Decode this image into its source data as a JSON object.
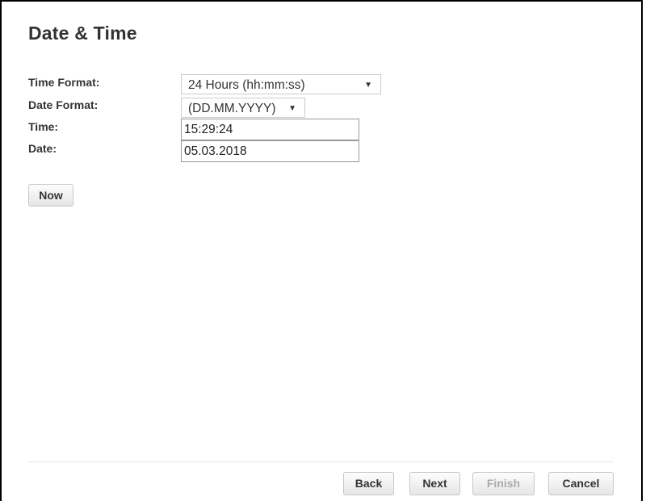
{
  "page": {
    "title": "Date & Time"
  },
  "form": {
    "time_format": {
      "label": "Time Format:",
      "value": "24 Hours (hh:mm:ss)"
    },
    "date_format": {
      "label": "Date Format:",
      "value": "(DD.MM.YYYY)"
    },
    "time": {
      "label": "Time:",
      "value": "15:29:24"
    },
    "date": {
      "label": "Date:",
      "value": "05.03.2018"
    }
  },
  "now_button": {
    "label": "Now"
  },
  "footer": {
    "back_label": "Back",
    "next_label": "Next",
    "finish_label": "Finish",
    "finish_enabled": false,
    "cancel_label": "Cancel"
  },
  "icons": {
    "dropdown_arrow": "▼"
  }
}
